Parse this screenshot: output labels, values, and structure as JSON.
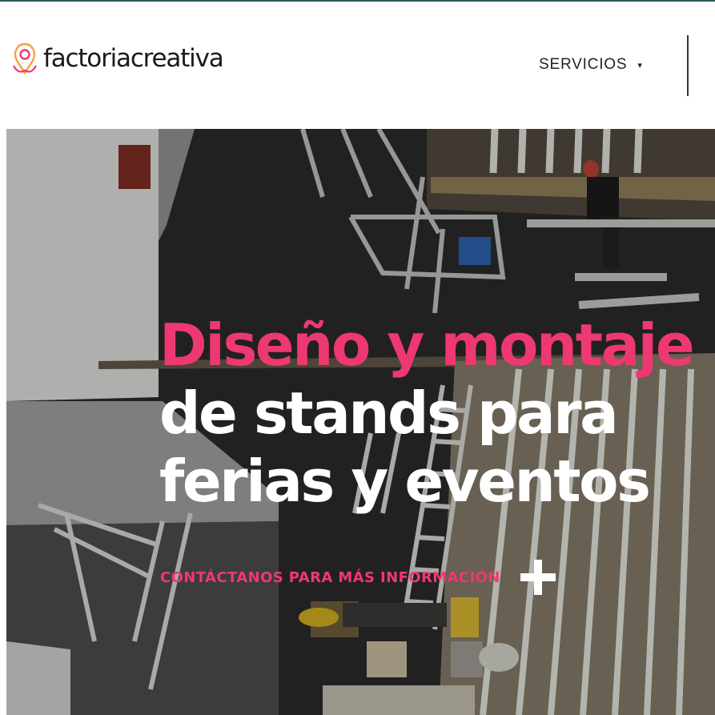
{
  "header": {
    "logo_text": "factoriacreativa",
    "nav": {
      "servicios_label": "SERVICIOS",
      "caret": "▾"
    }
  },
  "hero": {
    "headline_line1": "Diseño y montaje",
    "headline_line2": "de stands para",
    "headline_line3": "ferias y eventos",
    "cta_label": "CONTÁCTANOS PARA MÁS INFORMACIÓN",
    "cta_icon": "plus-icon"
  },
  "colors": {
    "accent_pink": "#ee3872",
    "text_dark": "#1a1a1a",
    "top_line": "#2f5b5e",
    "hero_text": "#ffffff"
  }
}
